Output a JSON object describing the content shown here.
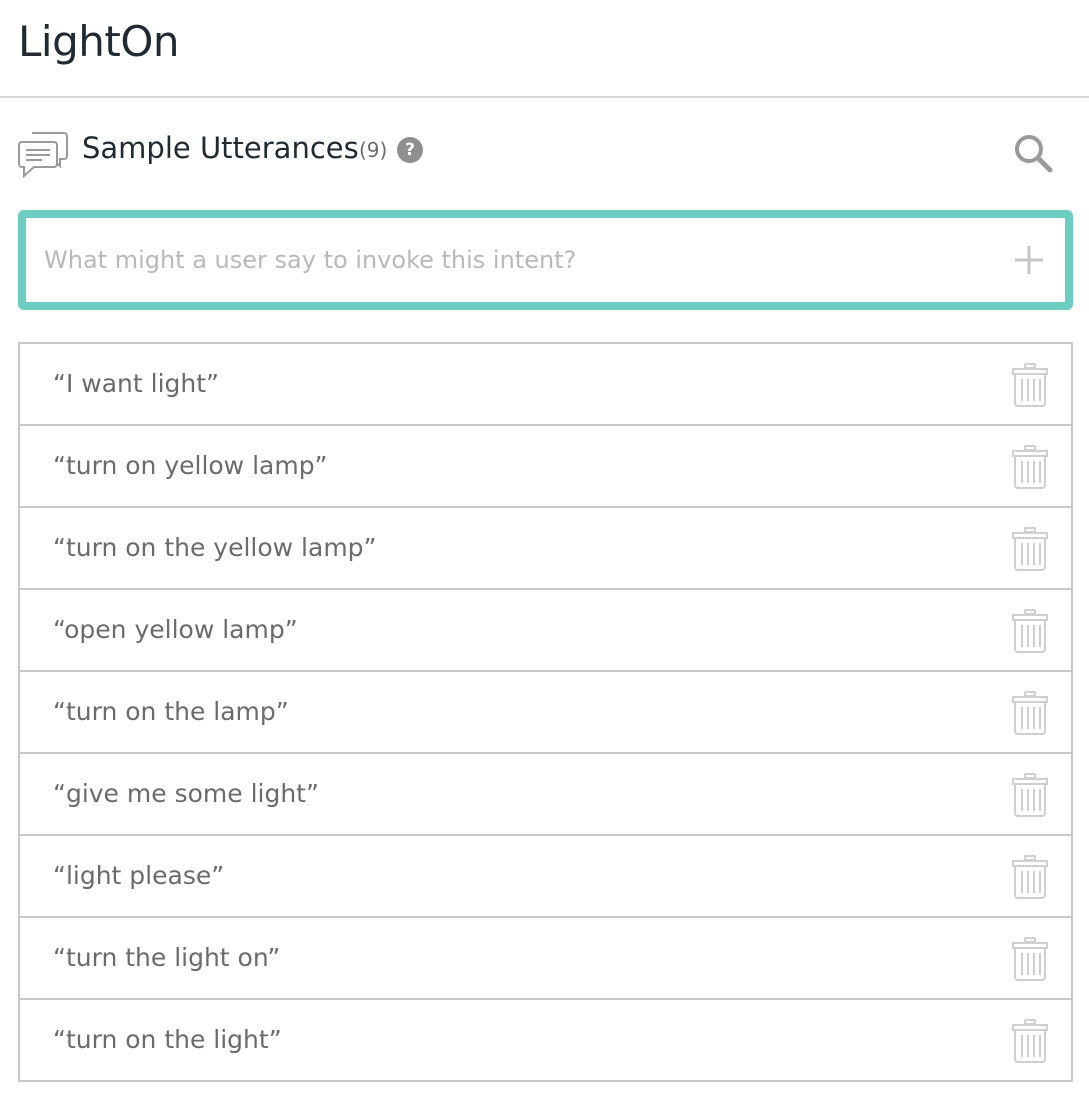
{
  "intent": {
    "title": "LightOn"
  },
  "section": {
    "icon": "chat-bubbles-icon",
    "title": "Sample Utterances",
    "count": "(9)",
    "help_glyph": "?"
  },
  "input": {
    "placeholder": "What might a user say to invoke this intent?",
    "value": "",
    "accent_color": "#6ccdc2"
  },
  "utterances": [
    "“I want light”",
    "“turn on yellow lamp”",
    "“turn on the yellow lamp”",
    "“open yellow lamp”",
    "“turn on the lamp”",
    "“give me some light”",
    "“light please”",
    "“turn the light on”",
    "“turn on the light”"
  ]
}
